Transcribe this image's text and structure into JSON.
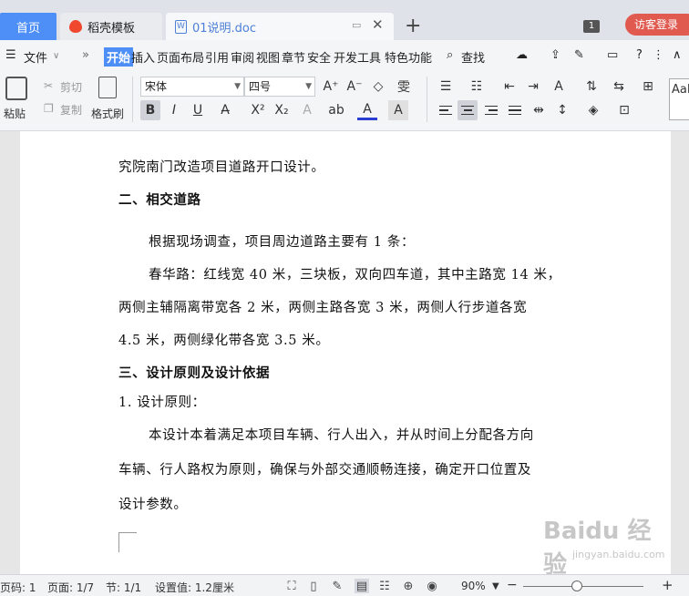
{
  "tabs": {
    "home": "首页",
    "daoke": "稻壳模板",
    "doc": "01说明.doc"
  },
  "tab_actions": {
    "badge": "1",
    "visitor": "访客登录"
  },
  "menu": {
    "file": "文件",
    "items": [
      "开始",
      "插入",
      "页面布局",
      "引用",
      "审阅",
      "视图",
      "章节",
      "安全",
      "开发工具",
      "特色功能"
    ],
    "search": "查找"
  },
  "ribbon": {
    "paste": "粘贴",
    "cut": "剪切",
    "copy": "复制",
    "format_painter": "格式刷",
    "font": "宋体",
    "size": "四号",
    "style_preview": "AaB"
  },
  "document": {
    "lines": [
      "究院南门改造项目道路开口设计。",
      "二、相交道路",
      "根据现场调查，项目周边道路主要有 1 条：",
      "春华路：红线宽 40 米，三块板，双向四车道，其中主路宽 14 米，",
      "两侧主辅隔离带宽各 2 米，两侧主路各宽 3 米，两侧人行步道各宽",
      "4.5 米，两侧绿化带各宽 3.5 米。",
      "三、设计原则及设计依据",
      "1. 设计原则：",
      "本设计本着满足本项目车辆、行人出入，并从时间上分配各方向",
      "车辆、行人路权为原则，确保与外部交通顺畅连接，确定开口位置及",
      "设计参数。"
    ],
    "watermark": "Baidu 经验",
    "watermark_sub": "jingyan.baidu.com"
  },
  "status": {
    "page_code": "页码: 1",
    "page": "页面: 1/7",
    "section": "节: 1/1",
    "setting": "设置值: 1.2厘米",
    "zoom": "90%",
    "zoom_level": 0.45
  }
}
